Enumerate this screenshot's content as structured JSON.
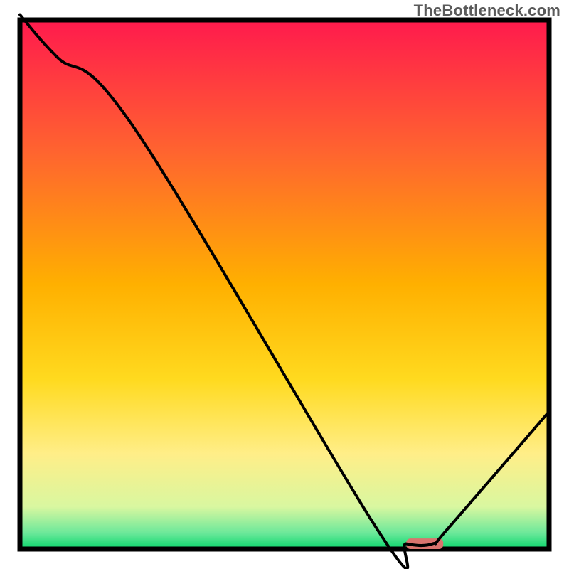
{
  "attribution": "TheBottleneck.com",
  "chart_data": {
    "type": "line",
    "title": "",
    "xlabel": "",
    "ylabel": "",
    "xlim": [
      0,
      100
    ],
    "ylim": [
      0,
      100
    ],
    "axes_visible": false,
    "grid": false,
    "background_gradient": [
      "#ff1a4d",
      "#ff8a2a",
      "#ffd400",
      "#ffee88",
      "#09d66b"
    ],
    "series": [
      {
        "name": "bottleneck-curve",
        "color": "#000000",
        "x": [
          0,
          7,
          22,
          68,
          73,
          78,
          81,
          100
        ],
        "values": [
          101,
          93,
          79,
          3,
          1,
          1,
          4,
          26
        ]
      }
    ],
    "marker": {
      "name": "optimum-marker",
      "color": "#d9746e",
      "x_start": 73,
      "x_end": 80,
      "y": 1,
      "height": 2
    }
  }
}
